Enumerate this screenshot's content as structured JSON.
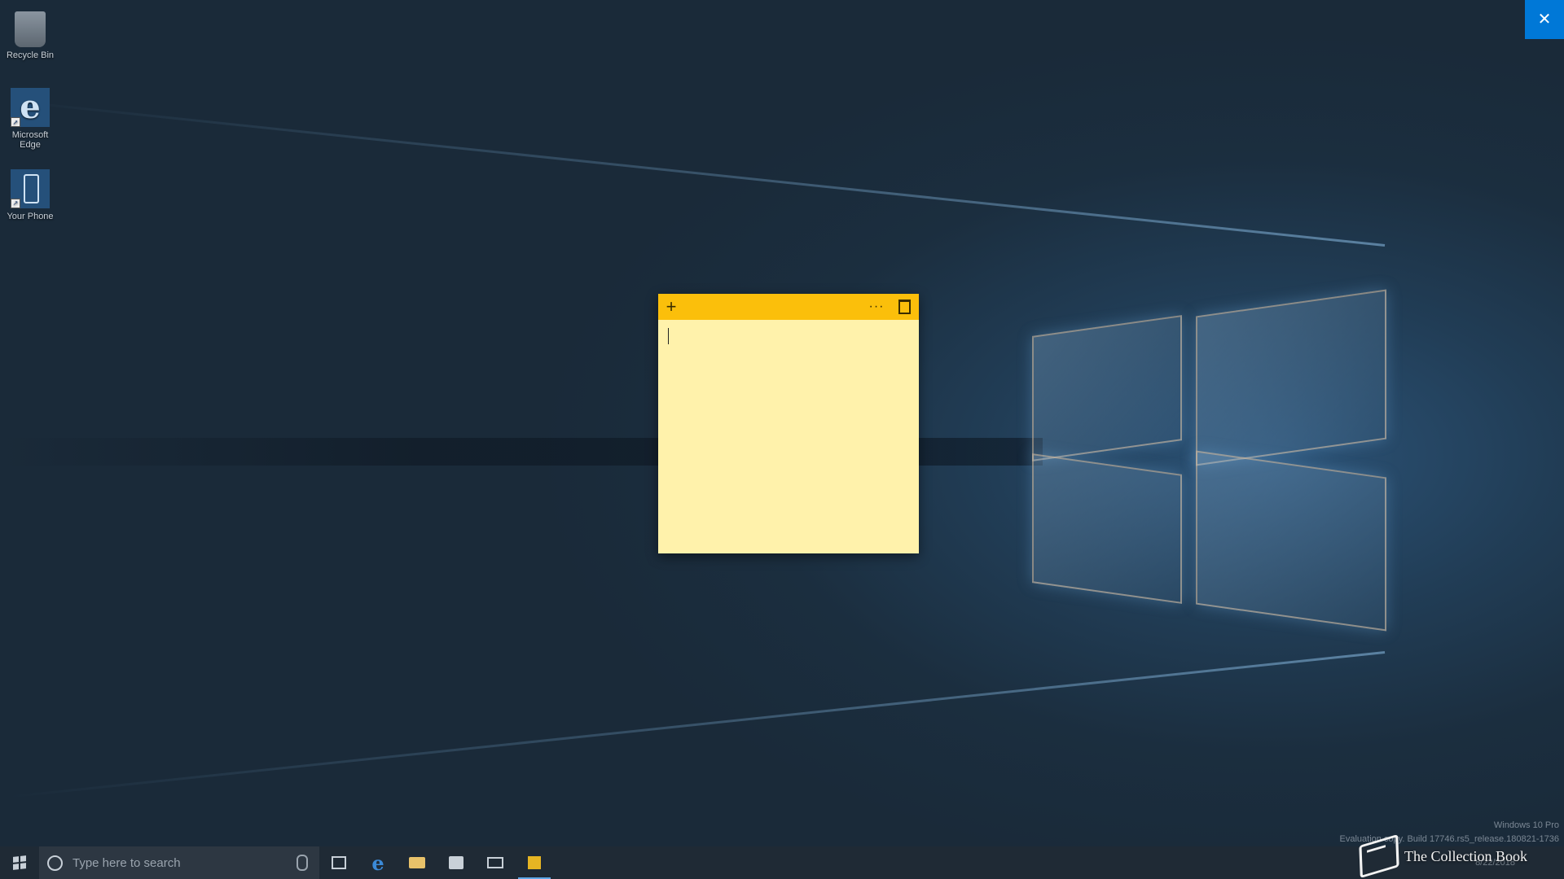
{
  "desktop": {
    "icons": [
      {
        "label": "Recycle Bin",
        "icon": "recycle-bin-icon"
      },
      {
        "label": "Microsoft Edge",
        "icon": "edge-icon"
      },
      {
        "label": "Your Phone",
        "icon": "phone-icon"
      }
    ]
  },
  "overlay": {
    "close_glyph": "✕"
  },
  "sticky_note": {
    "add_glyph": "+",
    "menu_glyph": "···",
    "body_text": "",
    "bar_color": "#fbbf0b",
    "body_color": "#fff2ab"
  },
  "watermark": {
    "edition": "Windows 10 Pro",
    "build": "Evaluation copy. Build 17746.rs5_release.180821-1736",
    "brand": "The Collection Book"
  },
  "taskbar": {
    "search_placeholder": "Type here to search",
    "date": "8/22/2018",
    "apps": [
      "task-view",
      "edge",
      "file-explorer",
      "store",
      "mail",
      "sticky-notes"
    ],
    "active_app": "sticky-notes",
    "accent": "#0078d7"
  }
}
